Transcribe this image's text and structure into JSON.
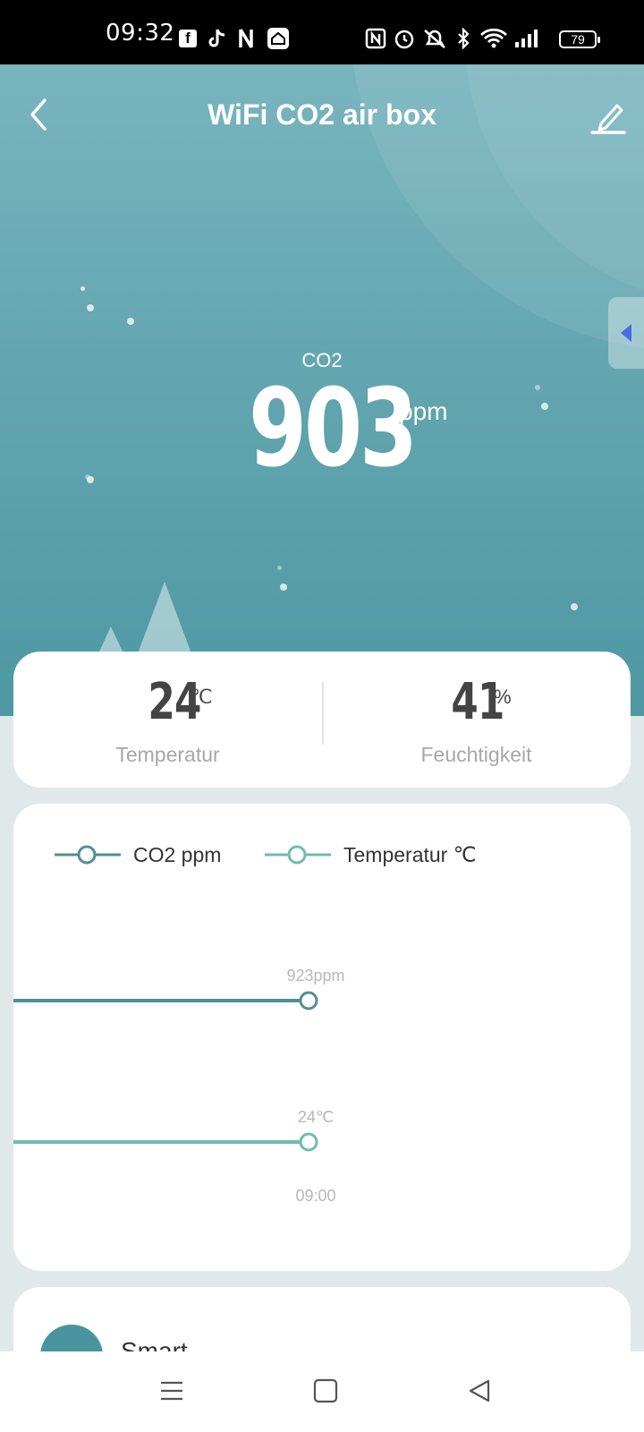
{
  "status_bar": {
    "time": "09:32",
    "left_icons": [
      "facebook-icon",
      "tiktok-icon",
      "netflix-icon",
      "home-app-icon"
    ],
    "right_icons": [
      "nfc-icon",
      "alarm-icon",
      "mute-icon",
      "bluetooth-icon",
      "wifi-icon",
      "signal-icon"
    ],
    "battery": "79"
  },
  "header": {
    "title": "WiFi CO2 air box",
    "back_icon": "chevron-left-icon",
    "edit_icon": "pencil-icon"
  },
  "main": {
    "co2_label": "CO2",
    "co2_value": "903",
    "co2_unit": "ppm"
  },
  "stats": {
    "temperature": {
      "value": "24",
      "unit": "℃",
      "label": "Temperatur"
    },
    "humidity": {
      "value": "41",
      "unit": "%",
      "label": "Feuchtigkeit"
    }
  },
  "chart_data": {
    "type": "line",
    "x": [
      "09:00"
    ],
    "series": [
      {
        "name": "CO2 ppm",
        "values": [
          923
        ],
        "label": "923ppm",
        "color": "#4f8f99"
      },
      {
        "name": "Temperatur ℃",
        "values": [
          24
        ],
        "label": "24℃",
        "color": "#6fbcb0"
      }
    ],
    "legend_position": "top-left",
    "grid": false
  },
  "smart": {
    "label": "Smart"
  },
  "colors": {
    "hero_top": "#79b5be",
    "hero_bottom": "#4e98a3",
    "co2_series": "#4f8f99",
    "temp_series": "#6fbcb0",
    "side_tab_arrow": "#4a6de0"
  },
  "nav_bar": {
    "icons": [
      "menu-icon",
      "home-square-icon",
      "back-triangle-icon"
    ]
  }
}
